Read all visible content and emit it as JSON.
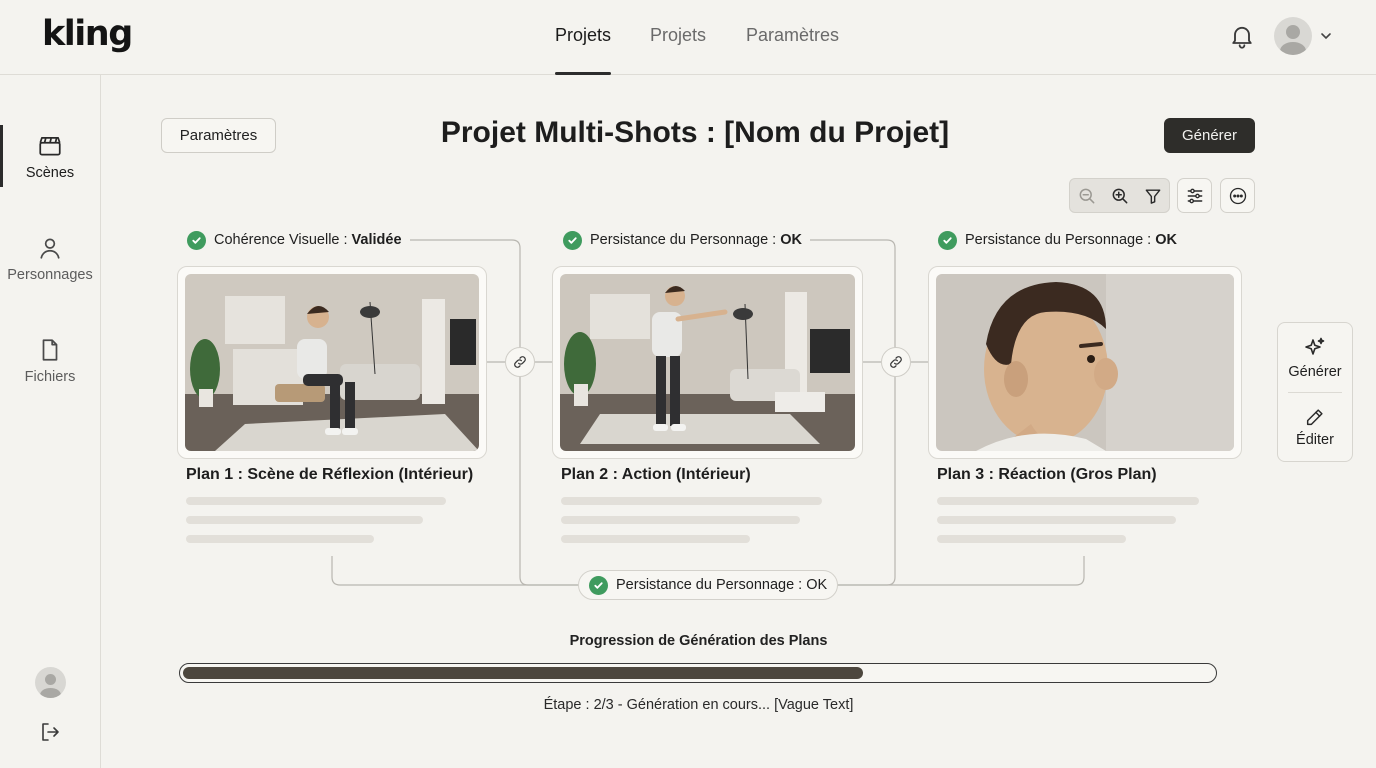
{
  "app": {
    "logo": "kling"
  },
  "nav": {
    "tabs": [
      {
        "label": "Projets",
        "active": true
      },
      {
        "label": "Projets",
        "active": false
      },
      {
        "label": "Paramètres",
        "active": false
      }
    ]
  },
  "header_icons": [
    "bell-icon",
    "user-avatar",
    "chevron-down-icon"
  ],
  "sidebar": {
    "items": [
      {
        "label": "Scènes",
        "icon": "clapperboard-icon",
        "active": true
      },
      {
        "label": "Personnages",
        "icon": "person-icon",
        "active": false
      },
      {
        "label": "Fichiers",
        "icon": "file-icon",
        "active": false
      }
    ],
    "bottom_icons": [
      "user-avatar",
      "logout-icon"
    ]
  },
  "toolbar": {
    "params_label": "Paramètres",
    "title": "Projet Multi-Shots : [Nom du Projet]",
    "generate_label": "Générer",
    "tool_icons": [
      "zoom-out-icon",
      "zoom-in-icon",
      "filter-icon",
      "sliders-icon",
      "more-icon"
    ]
  },
  "shots": [
    {
      "badge_label": "Cohérence Visuelle : ",
      "badge_value": "Validée",
      "title": "Plan 1 : Scène de Réflexion (Intérieur)"
    },
    {
      "badge_label": "Persistance du Personnage : ",
      "badge_value": "OK",
      "title": "Plan 2 : Action (Intérieur)"
    },
    {
      "badge_label": "Persistance du Personnage : ",
      "badge_value": "OK",
      "title": "Plan 3 : Réaction (Gros Plan)"
    }
  ],
  "bottom_badge": {
    "label": "Persistance du Personnage : OK"
  },
  "right_panel": {
    "generate_label": "Générer",
    "edit_label": "Éditer"
  },
  "progress": {
    "title": "Progression de Génération des Plans",
    "fraction": 0.66,
    "status": "Étape : 2/3 - Génération en cours... [Vague Text]"
  },
  "colors": {
    "accent_dark": "#2e2d2a",
    "check_green": "#3f9b5e",
    "background": "#f4f3ef"
  }
}
